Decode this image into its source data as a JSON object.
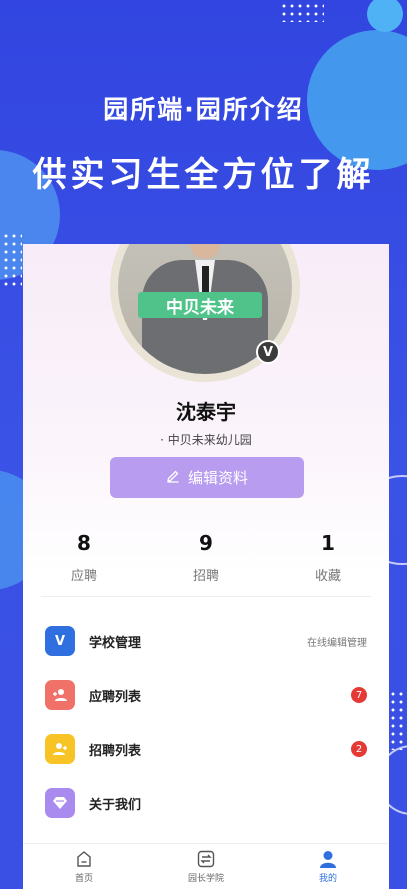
{
  "promo": {
    "line1": "园所端·园所介绍",
    "line2": "供实习生全方位了解"
  },
  "profile": {
    "avatar_logo_text": "中贝未来",
    "verified_badge": "V",
    "name": "沈泰宇",
    "school": "· 中贝未来幼儿园",
    "edit_button": "编辑资料"
  },
  "stats": [
    {
      "value": "8",
      "label": "应聘"
    },
    {
      "value": "9",
      "label": "招聘"
    },
    {
      "value": "1",
      "label": "收藏"
    }
  ],
  "menu": [
    {
      "label": "学校管理",
      "icon": "v-icon",
      "icon_text": "V",
      "color": "#2f6fe0",
      "right_text": "在线编辑管理"
    },
    {
      "label": "应聘列表",
      "icon": "add-user-icon",
      "color": "#f07167",
      "badge": "7"
    },
    {
      "label": "招聘列表",
      "icon": "add-user-icon",
      "color": "#f7c325",
      "badge": "2"
    },
    {
      "label": "关于我们",
      "icon": "diamond-icon",
      "color": "#a98bf0"
    }
  ],
  "tabs": [
    {
      "label": "首页",
      "icon": "home-icon"
    },
    {
      "label": "园长学院",
      "icon": "switch-icon"
    },
    {
      "label": "我的",
      "icon": "profile-icon",
      "active": true
    }
  ],
  "colors": {
    "background": "#3b4ee0",
    "accent_purple": "#b79cf0",
    "active_tab": "#2f6fe0",
    "badge_red": "#e53935"
  }
}
